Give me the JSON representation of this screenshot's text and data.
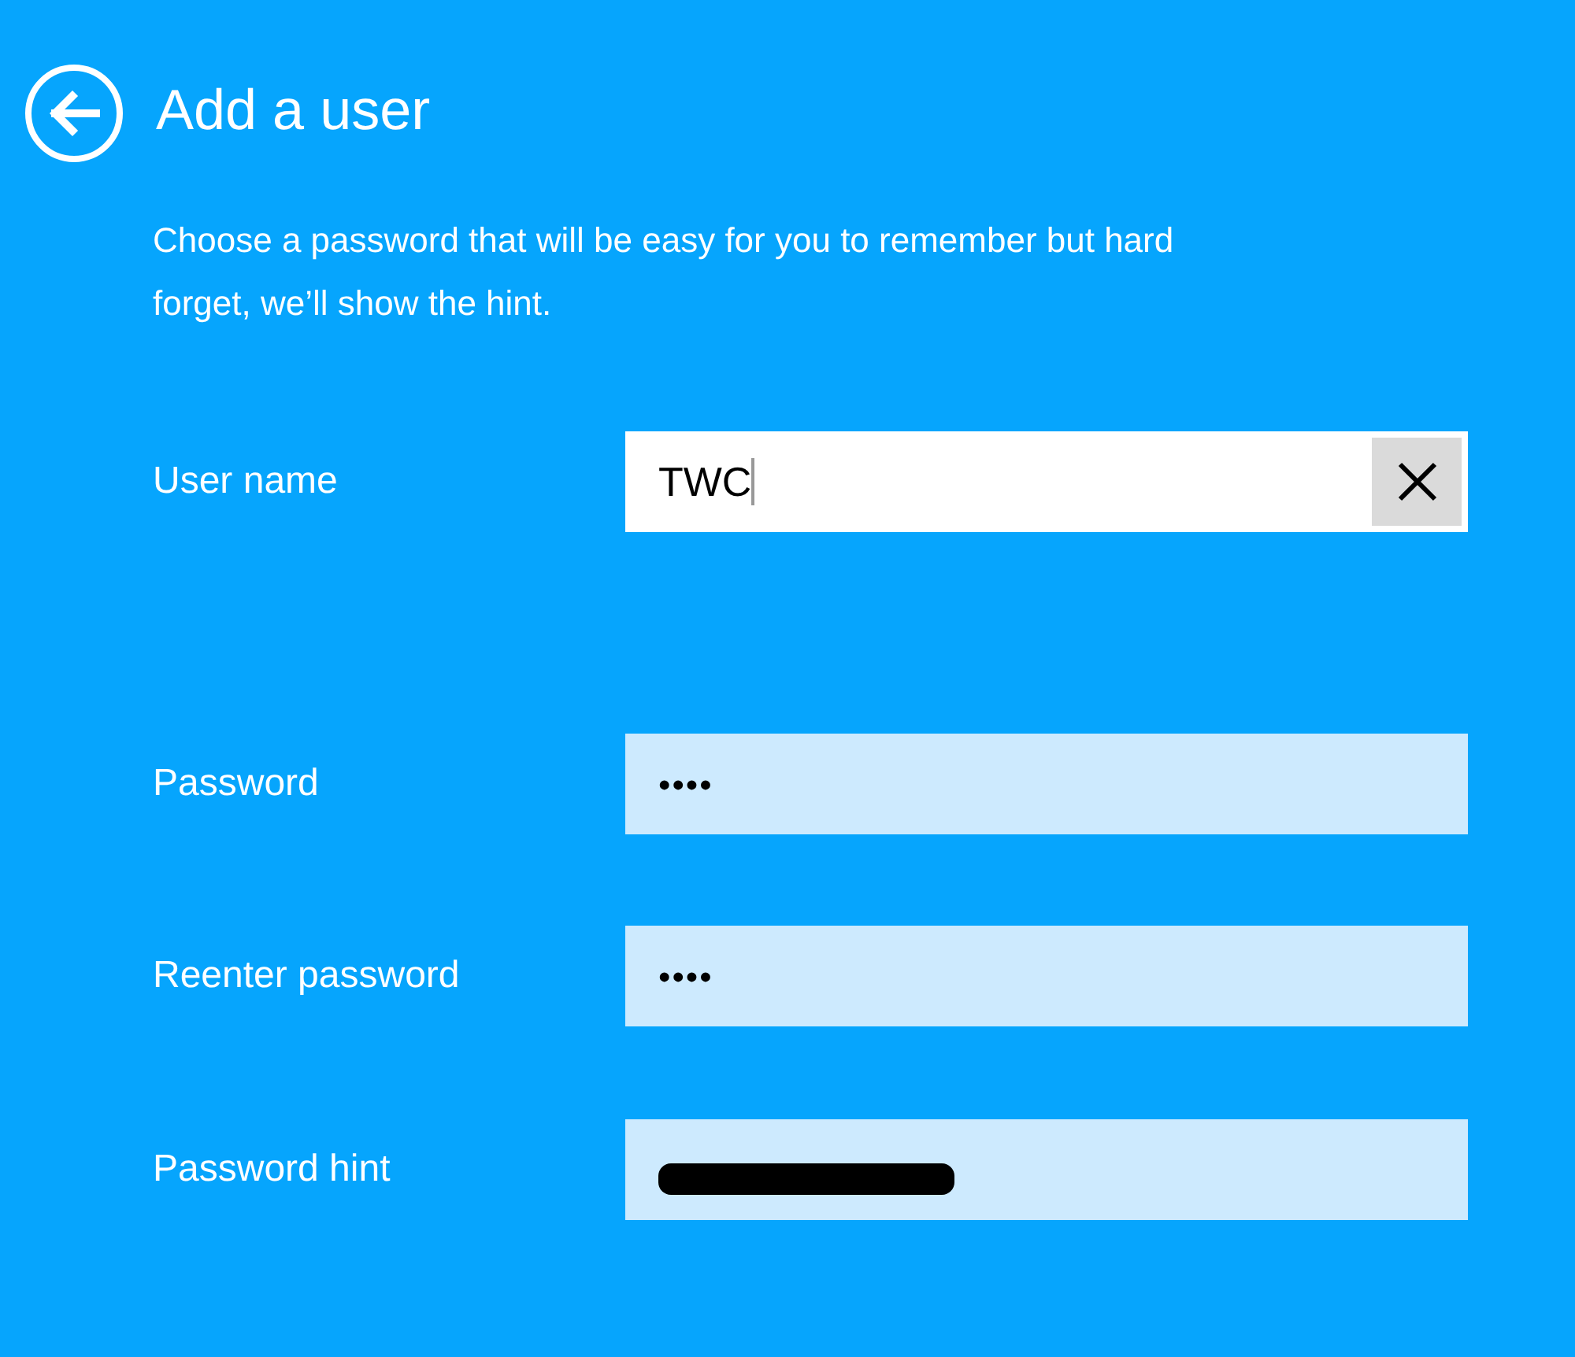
{
  "header": {
    "title": "Add a user"
  },
  "description": [
    "Choose a password that will be easy for you to remember but hard",
    "forget, we’ll show the hint."
  ],
  "fields": [
    {
      "kind": "text",
      "label": "User name",
      "value": "TWC",
      "focused": true
    },
    {
      "kind": "password",
      "label": "Password",
      "value": "••••",
      "focused": false
    },
    {
      "kind": "password",
      "label": "Reenter password",
      "value": "••••",
      "focused": false
    },
    {
      "kind": "redacted",
      "label": "Password hint",
      "focused": false
    }
  ]
}
